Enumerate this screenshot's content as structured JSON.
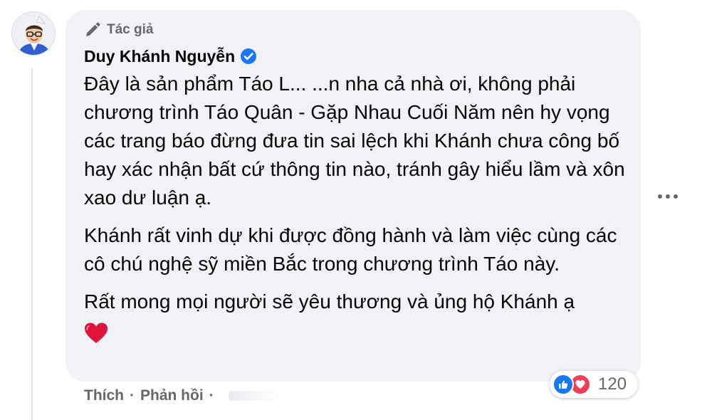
{
  "comment": {
    "author_badge": "Tác giả",
    "author_name": "Duy Khánh Nguyễn",
    "paragraphs": [
      "Đây là sản phẩm Táo L... ...n nha cả nhà ơi, không phải chương trình Táo Quân - Gặp Nhau Cuối Năm nên hy vọng các trang báo đừng đưa tin sai lệch khi Khánh chưa công bố hay xác nhận bất cứ thông tin nào, tránh gây hiểu lầm và xôn xao dư luận ạ.",
      "Khánh rất vinh dự khi được đồng hành và làm việc cùng các cô chú nghệ sỹ miền Bắc trong chương trình Táo này.",
      "Rất mong mọi người sẽ yêu thương và ủng hộ Khánh ạ"
    ],
    "emoji": "heart-emoji"
  },
  "actions": {
    "like_label": "Thích",
    "separator": "·",
    "reply_label": "Phản hồi"
  },
  "reactions": {
    "count": "120",
    "icons": [
      "like-icon",
      "love-icon"
    ]
  },
  "colors": {
    "bubble": "#f0f2f5",
    "muted_text": "#65676b",
    "verified_blue": "#1877f2",
    "love_red": "#f33e58"
  }
}
